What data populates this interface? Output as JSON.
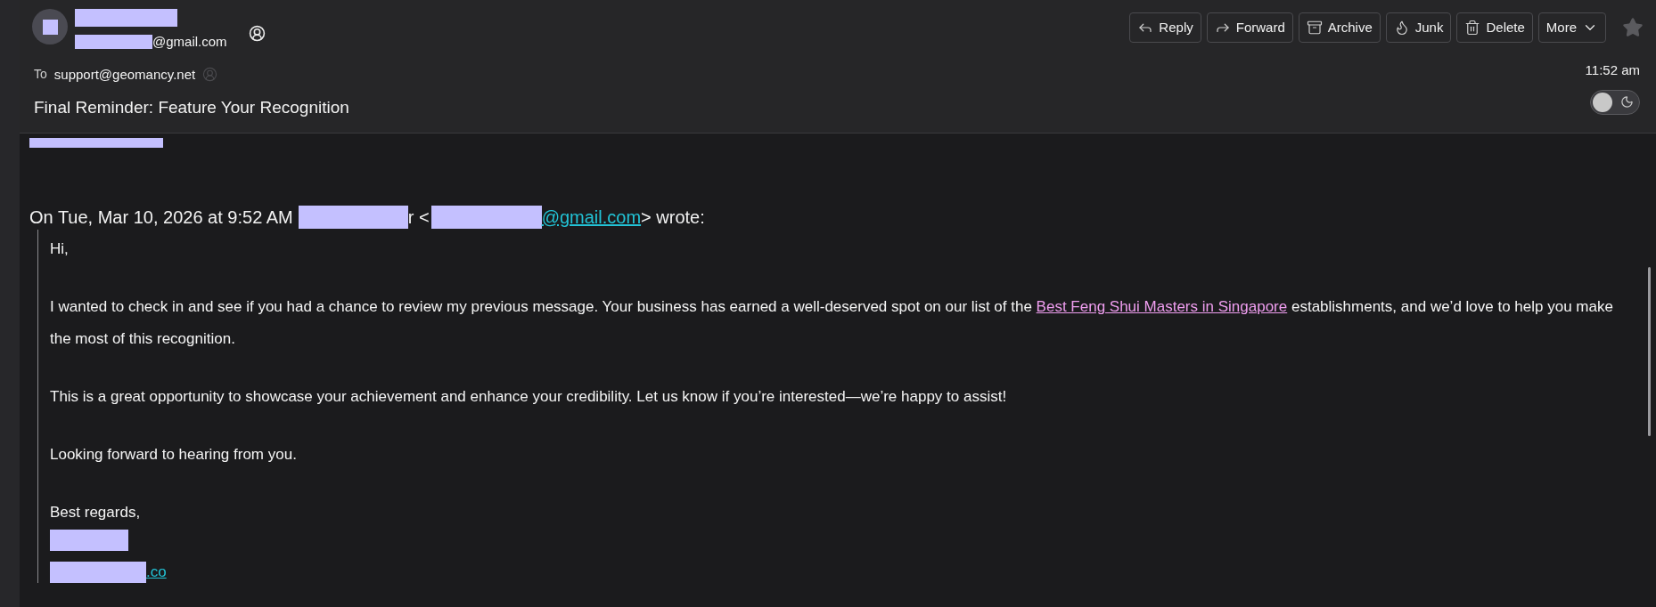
{
  "sender": {
    "email_suffix": "@gmail.com"
  },
  "recipient": {
    "label": "To",
    "address": "support@geomancy.net"
  },
  "subject": "Final Reminder: Feature Your Recognition",
  "time": "11:52 am",
  "toolbar": [
    {
      "label": "Reply",
      "kind": "reply"
    },
    {
      "label": "Forward",
      "kind": "forward"
    },
    {
      "label": "Archive",
      "kind": "archive"
    },
    {
      "label": "Junk",
      "kind": "junk"
    },
    {
      "label": "Delete",
      "kind": "delete"
    },
    {
      "label": "More",
      "kind": "menu"
    }
  ],
  "starred": false,
  "dark_toggle": {
    "on": false
  },
  "quote_header": {
    "intro": "On Tue, Mar 10, 2026 at 9:52 AM",
    "name_tail": "r <",
    "email_link": "@gmail.com",
    "outro": "> wrote:"
  },
  "body": [
    {
      "kind": "text",
      "text": "Hi,"
    },
    {
      "kind": "linked",
      "before": "I wanted to check in and see if you had a chance to review my previous message. Your business has earned a well-deserved spot on our list of the",
      "link": "Best Feng Shui Masters in Singapore",
      "after": "establishments, and we’d love to help you make the most of this recognition."
    },
    {
      "kind": "text",
      "text": "This is a great opportunity to showcase your achievement and enhance your credibility. Let us know if you’re interested—we’re happy to assist!"
    },
    {
      "kind": "text",
      "text": "Looking forward to hearing from you."
    },
    {
      "kind": "text",
      "text": "Best regards,"
    }
  ],
  "signature": {
    "link_tail": ".co"
  }
}
